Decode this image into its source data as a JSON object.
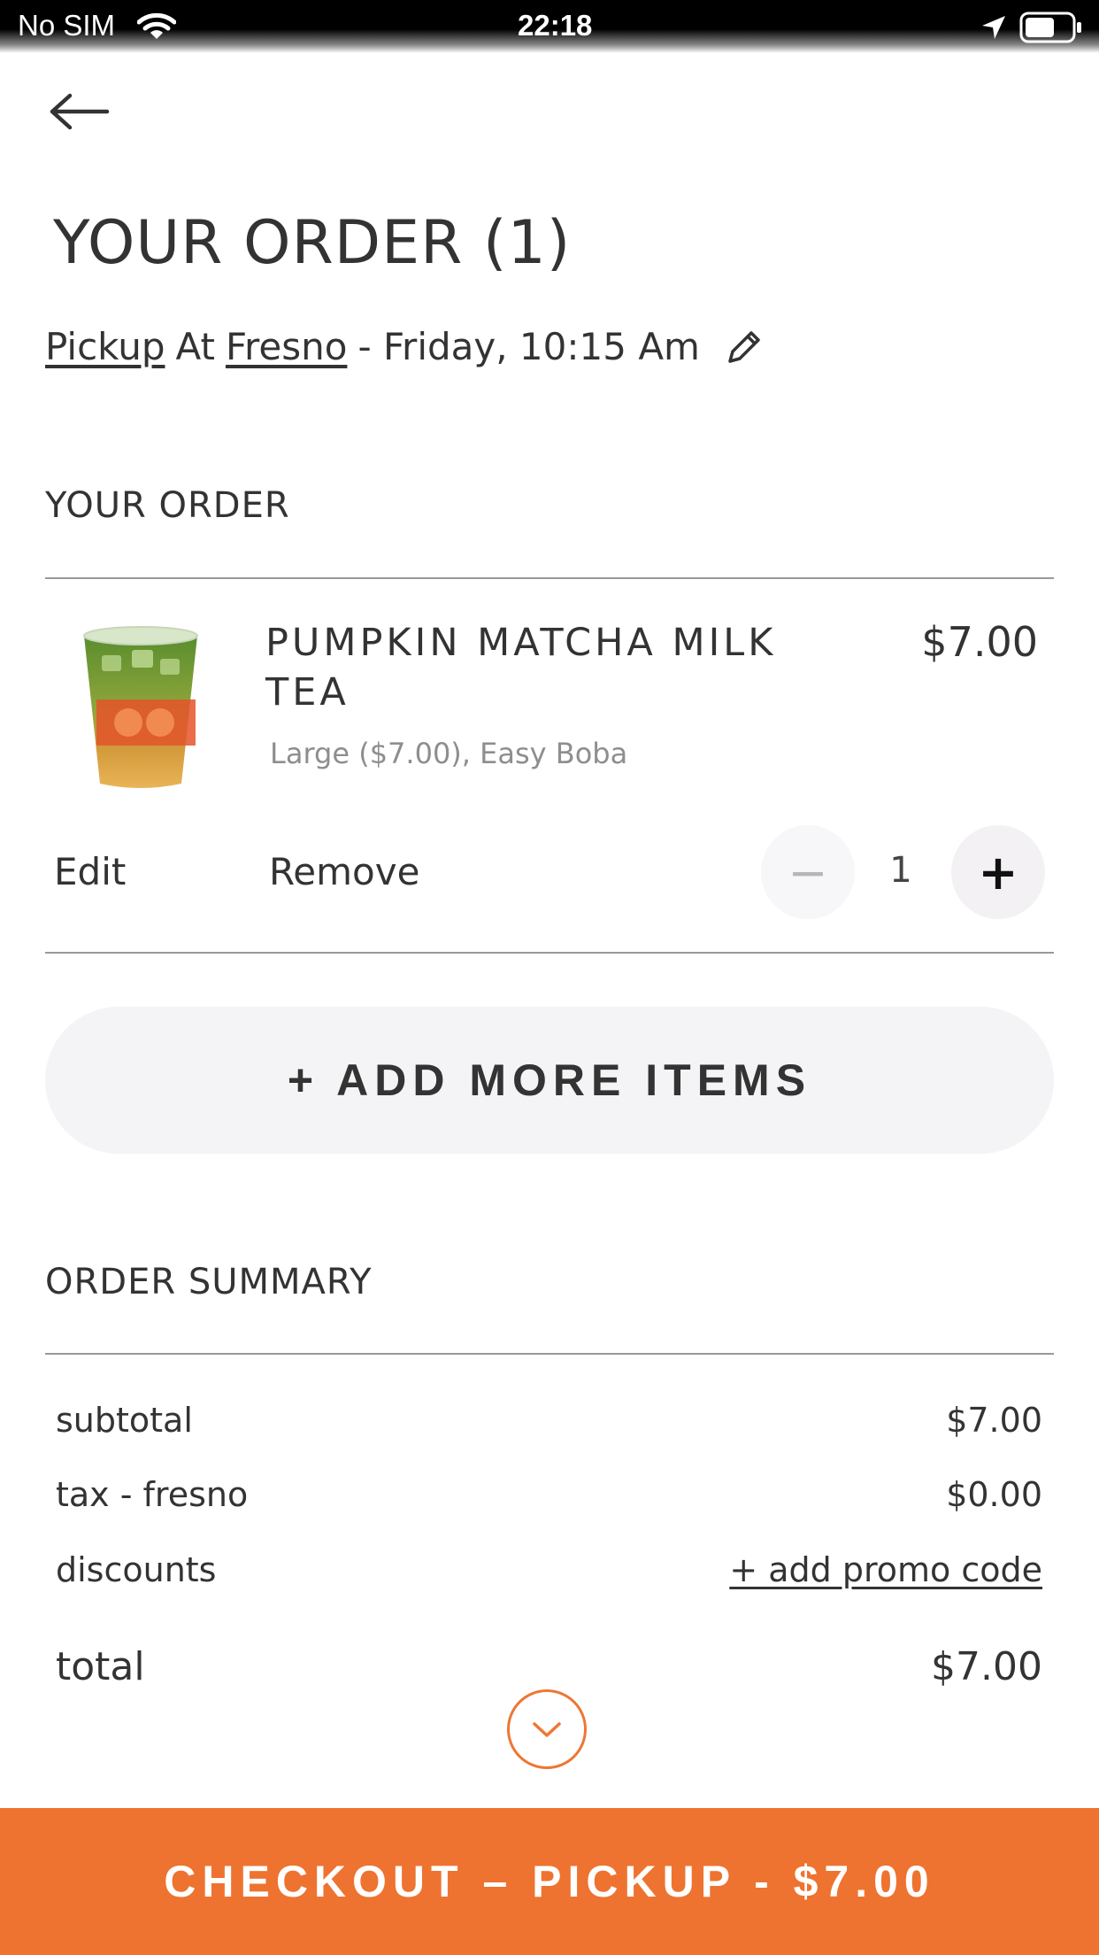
{
  "status_bar": {
    "carrier": "No SIM",
    "time": "22:18",
    "icons": [
      "wifi-icon",
      "location-arrow-icon",
      "battery-icon"
    ]
  },
  "header": {
    "back_icon": "arrow-left-icon",
    "title": "YOUR ORDER (1)"
  },
  "pickup": {
    "mode": "Pickup",
    "at": "At",
    "location": "Fresno",
    "datetime": "- Friday, 10:15 Am",
    "edit_icon": "pencil-icon"
  },
  "order": {
    "section_label": "YOUR ORDER",
    "item": {
      "name": "PUMPKIN MATCHA MILK TEA",
      "price": "$7.00",
      "modifiers": "Large ($7.00), Easy Boba",
      "image_icon": "milk-tea-cup-image",
      "edit_label": "Edit",
      "remove_label": "Remove",
      "quantity": "1",
      "minus_label": "−",
      "plus_label": "+"
    },
    "add_more_label": "+ ADD MORE ITEMS"
  },
  "summary": {
    "section_label": "ORDER SUMMARY",
    "subtotal_label": "subtotal",
    "subtotal_value": "$7.00",
    "tax_label": "tax - fresno",
    "tax_value": "$0.00",
    "discounts_label": "discounts",
    "promo_label": "+ add promo code",
    "total_label": "total",
    "total_value": "$7.00"
  },
  "checkout": {
    "label": "CHECKOUT – PICKUP - $7.00"
  },
  "colors": {
    "accent": "#ee7330",
    "text": "#333333",
    "muted": "#8e8e8e",
    "pill_bg": "#f4f3f5"
  }
}
